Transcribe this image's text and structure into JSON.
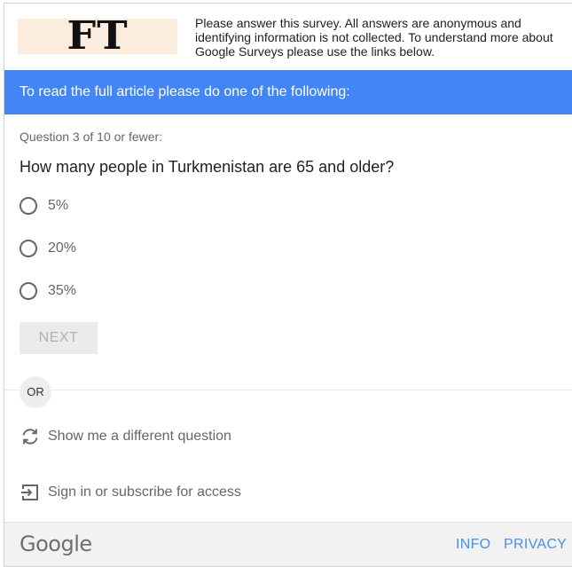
{
  "header": {
    "logo_text": "FT",
    "description": "Please answer this survey. All answers are anonymous and identifying information is not collected. To understand more about Google Surveys please use the links below."
  },
  "banner": {
    "text": "To read the full article please do one of the following:"
  },
  "survey": {
    "question_count": "Question 3 of 10 or fewer:",
    "question": "How many people in Turkmenistan are 65 and older?",
    "options": [
      "5%",
      "20%",
      "35%"
    ],
    "next_label": "NEXT"
  },
  "or_label": "OR",
  "alternatives": {
    "different_question": "Show me a different question",
    "sign_in": "Sign in or subscribe for access"
  },
  "footer": {
    "brand": "Google",
    "info_label": "INFO",
    "privacy_label": "PRIVACY"
  },
  "colors": {
    "banner": "#4285f4",
    "logo_background": "#fcecdd",
    "link": "#4a8fe7",
    "footer_background": "#f2f2f2"
  },
  "icons": {
    "refresh": "refresh-icon",
    "sign_in": "sign-in-icon",
    "radio": "radio-unchecked-icon"
  }
}
